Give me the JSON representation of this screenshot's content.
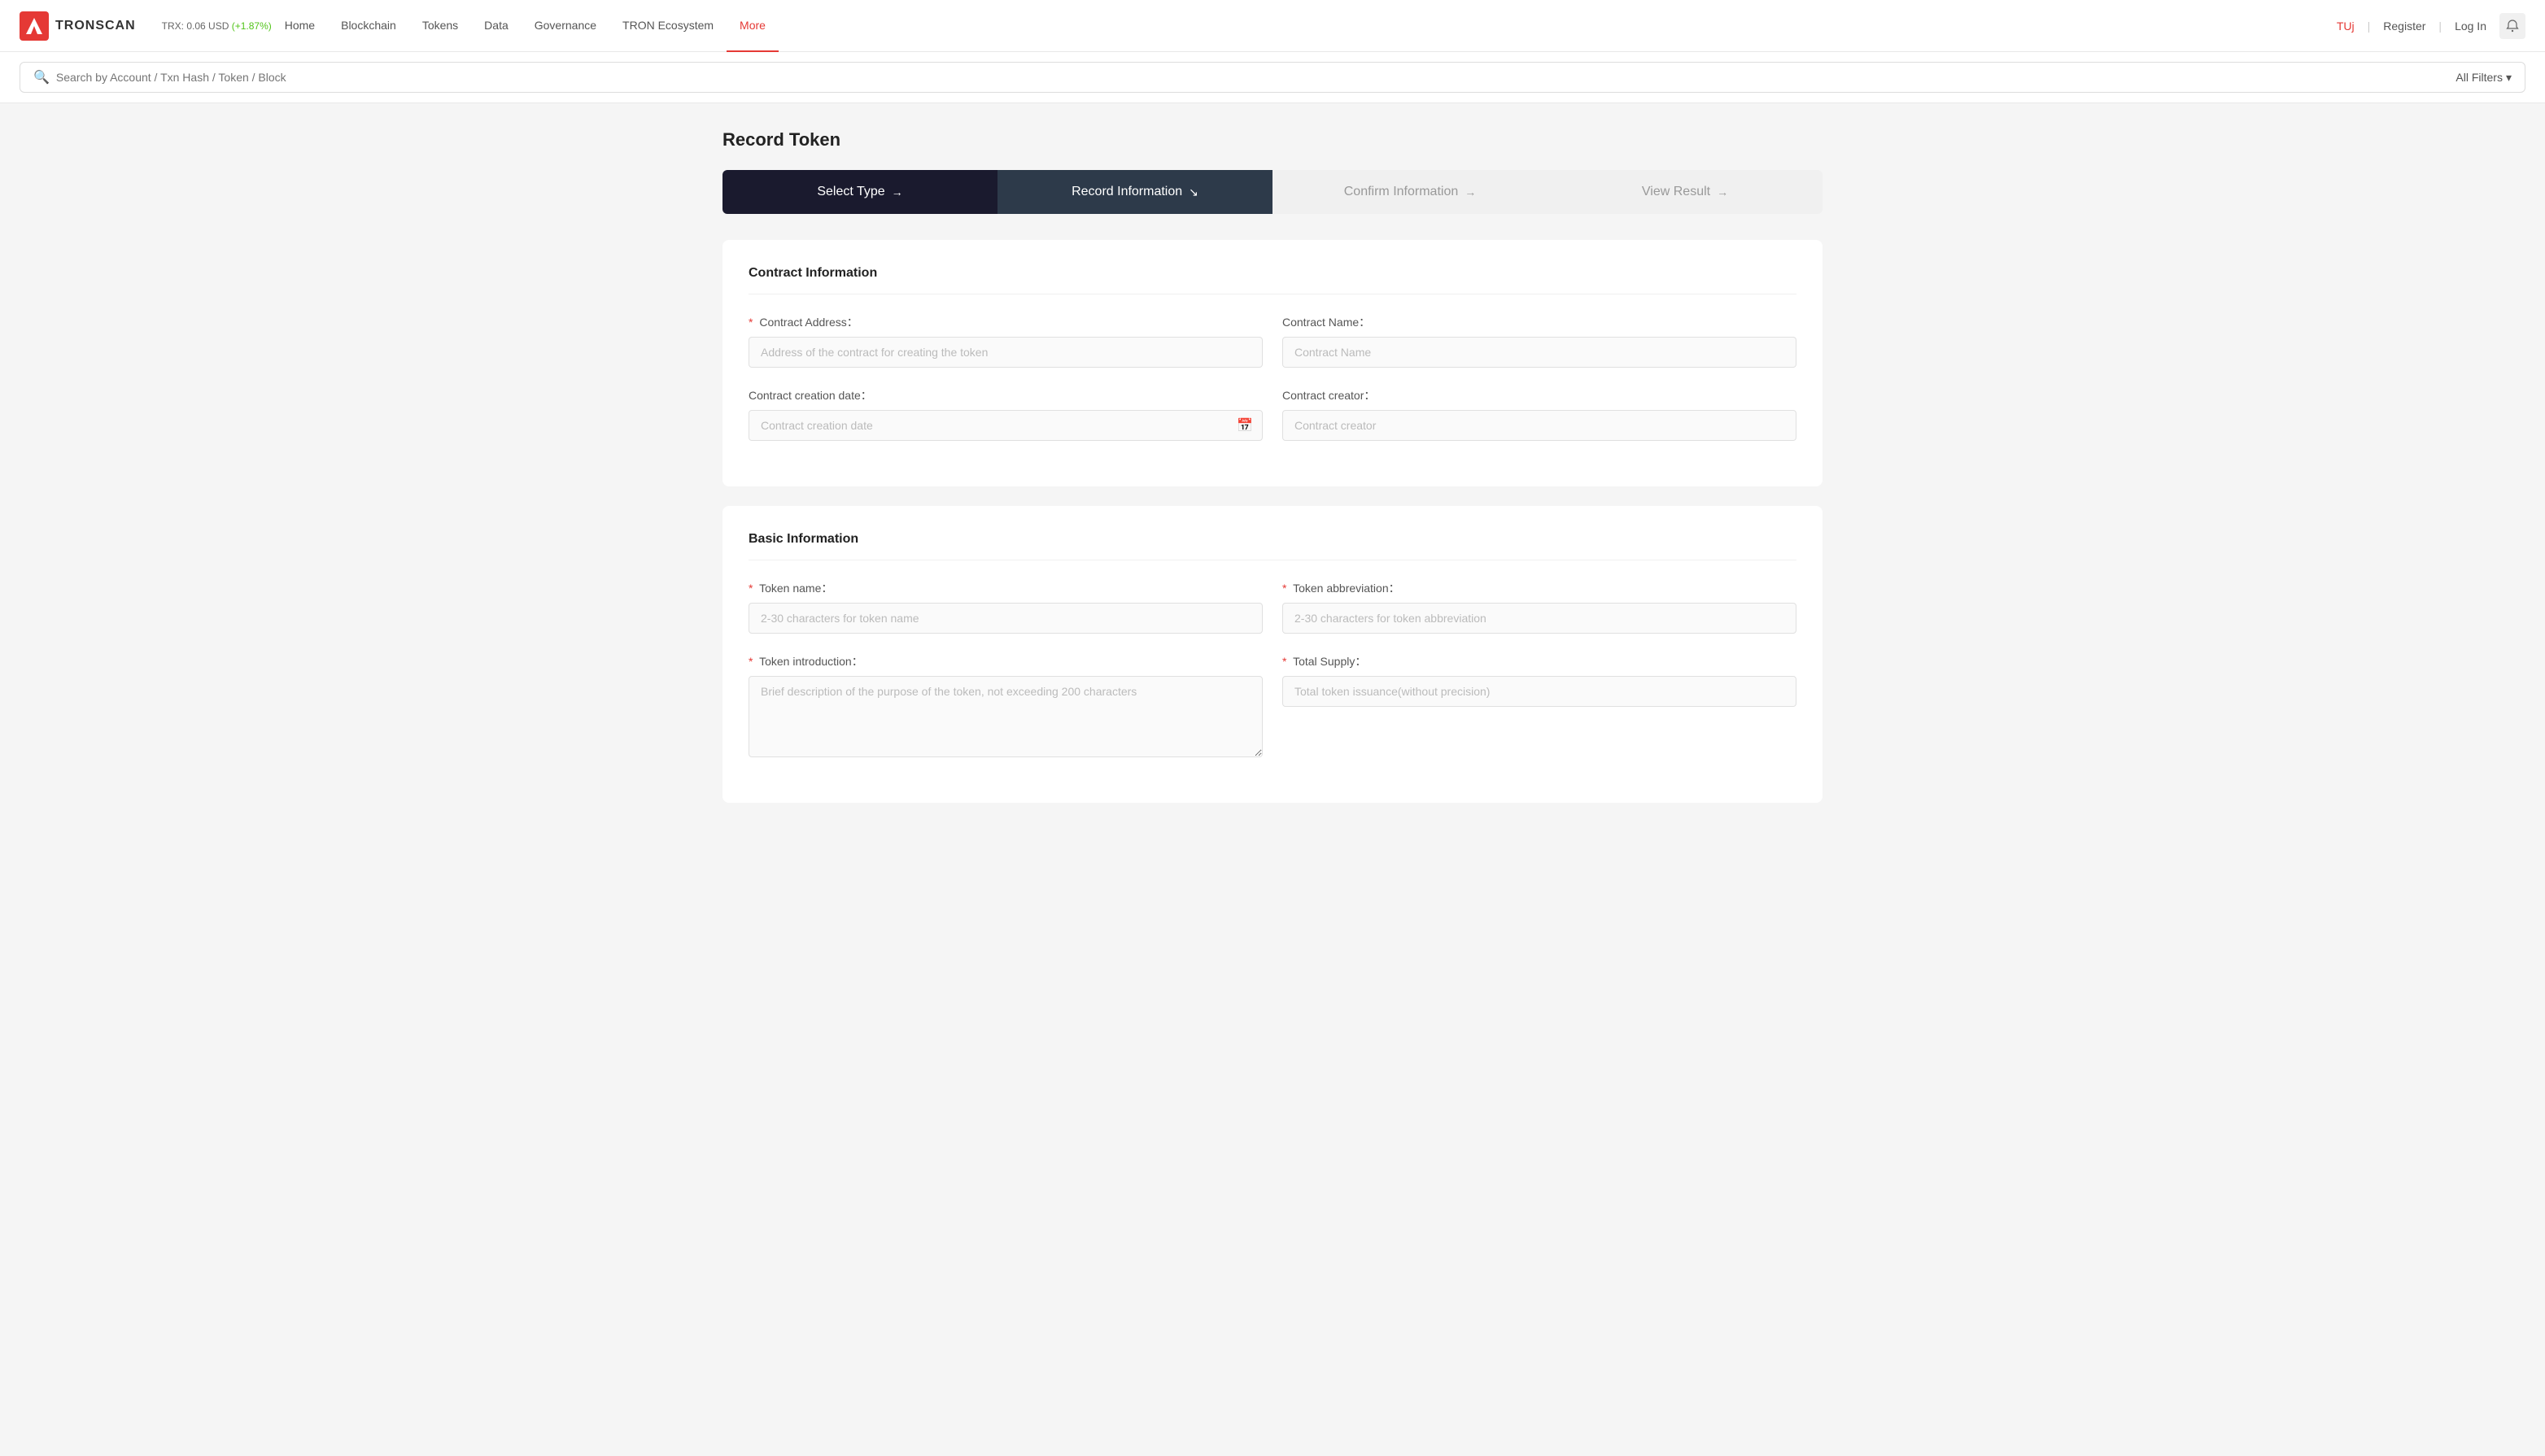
{
  "brand": {
    "name": "TRONSCAN",
    "trx_price": "TRX: 0.06 USD",
    "trx_change": "(+1.87%)"
  },
  "nav": {
    "items": [
      {
        "id": "home",
        "label": "Home",
        "active": false
      },
      {
        "id": "blockchain",
        "label": "Blockchain",
        "active": false
      },
      {
        "id": "tokens",
        "label": "Tokens",
        "active": false
      },
      {
        "id": "data",
        "label": "Data",
        "active": false
      },
      {
        "id": "governance",
        "label": "Governance",
        "active": false
      },
      {
        "id": "tron-ecosystem",
        "label": "TRON Ecosystem",
        "active": false
      },
      {
        "id": "more",
        "label": "More",
        "active": true
      }
    ],
    "user": "TUj",
    "register": "Register",
    "login": "Log In"
  },
  "search": {
    "placeholder": "Search by Account / Txn Hash / Token / Block",
    "filter_label": "All Filters"
  },
  "page": {
    "title": "Record Token"
  },
  "steps": [
    {
      "id": "select-type",
      "label": "Select Type",
      "arrow": "→",
      "state": "active"
    },
    {
      "id": "record-information",
      "label": "Record Information",
      "arrow": "↘",
      "state": "current"
    },
    {
      "id": "confirm-information",
      "label": "Confirm Information",
      "arrow": "→",
      "state": "inactive"
    },
    {
      "id": "view-result",
      "label": "View Result",
      "arrow": "→",
      "state": "inactive"
    }
  ],
  "contract_info": {
    "section_title": "Contract Information",
    "fields": {
      "contract_address": {
        "label": "Contract Address：",
        "required": true,
        "placeholder": "Address of the contract for creating the token"
      },
      "contract_name": {
        "label": "Contract Name：",
        "required": false,
        "placeholder": "Contract Name"
      },
      "contract_creation_date": {
        "label": "Contract creation date：",
        "required": false,
        "placeholder": "Contract creation date"
      },
      "contract_creator": {
        "label": "Contract creator：",
        "required": false,
        "placeholder": "Contract creator"
      }
    }
  },
  "basic_info": {
    "section_title": "Basic Information",
    "fields": {
      "token_name": {
        "label": "Token name：",
        "required": true,
        "placeholder": "2-30 characters for token name"
      },
      "token_abbreviation": {
        "label": "Token abbreviation：",
        "required": true,
        "placeholder": "2-30 characters for token abbreviation"
      },
      "token_introduction": {
        "label": "Token introduction：",
        "required": true,
        "placeholder": "Brief description of the purpose of the token, not exceeding 200 characters"
      },
      "total_supply": {
        "label": "Total Supply：",
        "required": true,
        "placeholder": "Total token issuance(without precision)"
      }
    }
  }
}
